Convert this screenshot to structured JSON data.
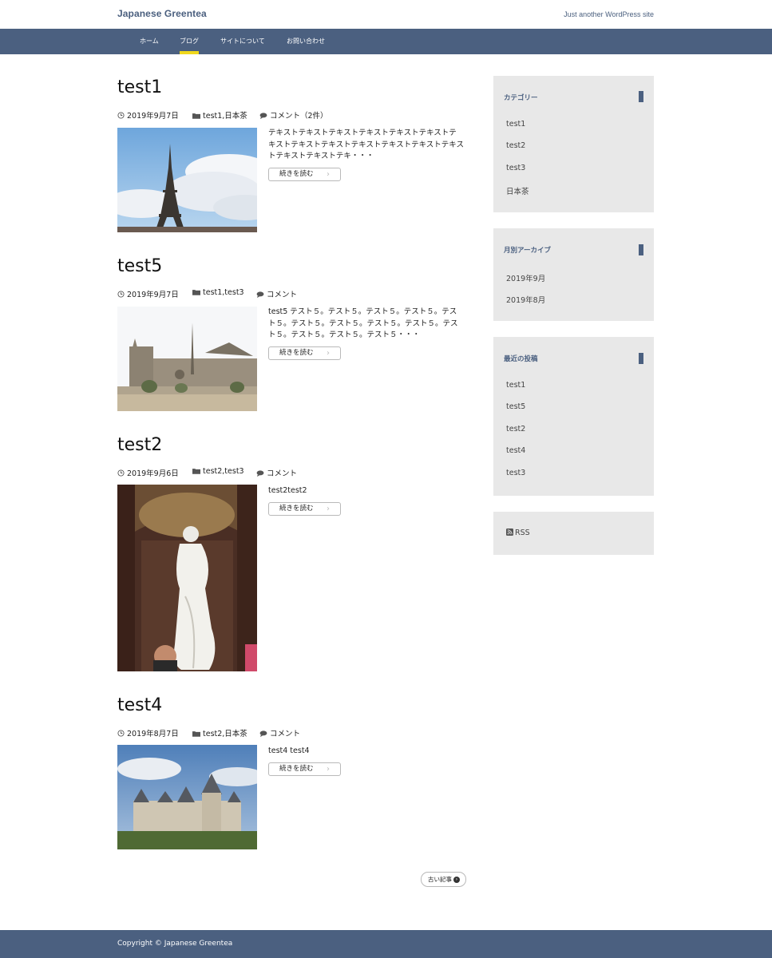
{
  "header": {
    "site_title": "Japanese Greentea",
    "description": "Just another WordPress site"
  },
  "nav": {
    "items": [
      "ホーム",
      "ブログ",
      "サイトについて",
      "お問い合わせ"
    ],
    "current": "ブログ"
  },
  "posts": [
    {
      "title": "test1",
      "date": "2019年9月7日",
      "categories": "test1,日本茶",
      "comments": "コメント（2件）",
      "excerpt": "テキストテキストテキストテキストテキストテキストテキストテキストテキストテキストテキストテキストテキストテキストテキストテキ・・・",
      "image": "eiffel-tower-photo",
      "more_label": "続きを読む"
    },
    {
      "title": "test5",
      "date": "2019年9月7日",
      "categories": "test1,test3",
      "comments": "コメント",
      "excerpt": "test5 テスト５。テスト５。テスト５。テスト５。テスト５。テスト５。テスト５。テスト５。テスト５。テスト５。テスト５。テスト５。テスト５・・・",
      "image": "notre-dame-photo",
      "more_label": "続きを読む"
    },
    {
      "title": "test2",
      "date": "2019年9月6日",
      "categories": "test2,test3",
      "comments": "コメント",
      "excerpt": "test2test2",
      "image": "venus-de-milo-photo",
      "more_label": "続きを読む"
    },
    {
      "title": "test4",
      "date": "2019年8月7日",
      "categories": "test2,日本茶",
      "comments": "コメント",
      "excerpt": "test4 test4",
      "image": "chateau-photo",
      "more_label": "続きを読む"
    }
  ],
  "pagination": {
    "older_label": "古い記事"
  },
  "sidebar": {
    "categories": {
      "title": "カテゴリー",
      "items": [
        "test1",
        "test2",
        "test3",
        "日本茶"
      ]
    },
    "archives": {
      "title": "月別アーカイブ",
      "items": [
        "2019年9月",
        "2019年8月"
      ]
    },
    "recent": {
      "title": "最近の投稿",
      "items": [
        "test1",
        "test5",
        "test2",
        "test4",
        "test3"
      ]
    },
    "rss_label": "RSS"
  },
  "footer": {
    "copyright": "Copyright © Japanese Greentea"
  },
  "colors": {
    "brand": "#4b6080",
    "accent": "#f0d81c",
    "widget_bg": "#e8e8e8"
  }
}
